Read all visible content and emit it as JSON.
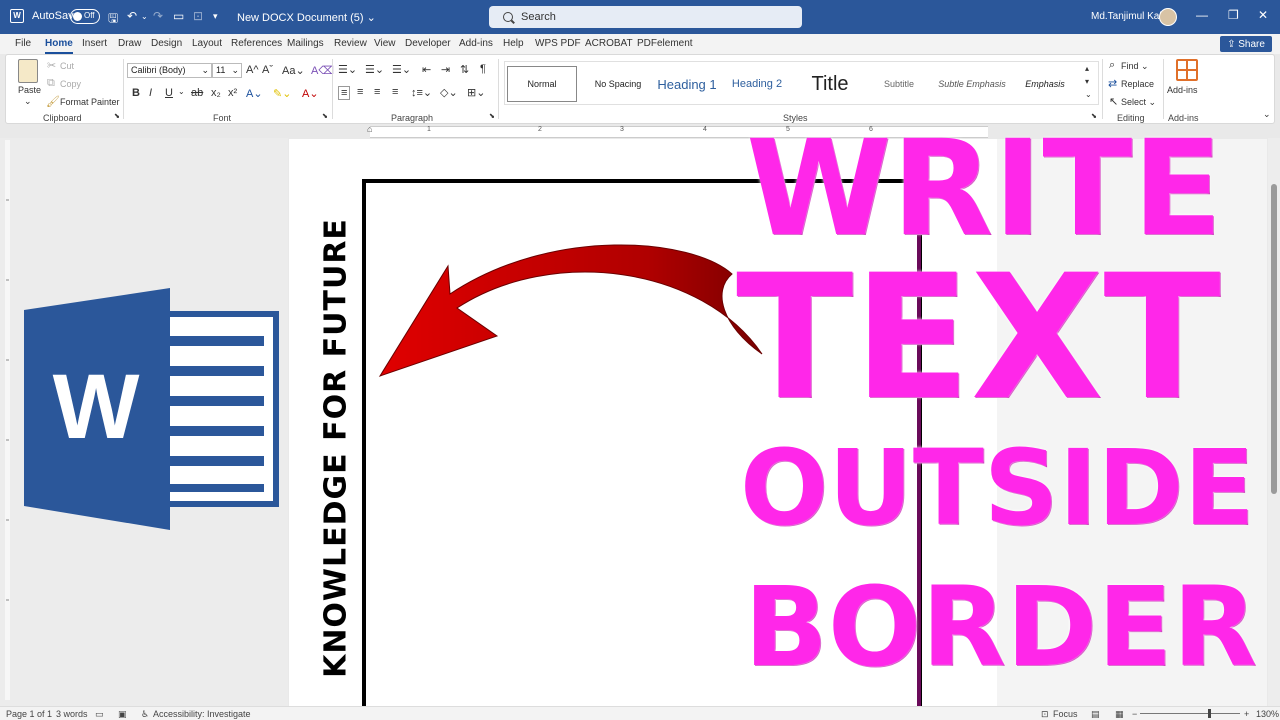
{
  "titlebar": {
    "autosave_label": "AutoSave",
    "autosave_state": "Off",
    "doc_title": "New DOCX Document (5)",
    "search_placeholder": "Search",
    "user_name": "Md.Tanjimul Kabir"
  },
  "menu": {
    "tabs": [
      "File",
      "Home",
      "Insert",
      "Draw",
      "Design",
      "Layout",
      "References",
      "Mailings",
      "Review",
      "View",
      "Developer",
      "Add-ins",
      "Help",
      "WPS PDF",
      "ACROBAT",
      "PDFelement"
    ],
    "active": "Home",
    "share_label": "Share"
  },
  "ribbon": {
    "clipboard": {
      "paste": "Paste",
      "cut": "Cut",
      "copy": "Copy",
      "format_painter": "Format Painter",
      "label": "Clipboard"
    },
    "font": {
      "name": "Calibri (Body)",
      "size": "11",
      "label": "Font"
    },
    "paragraph": {
      "label": "Paragraph"
    },
    "styles": {
      "items": [
        "Normal",
        "No Spacing",
        "Heading 1",
        "Heading 2",
        "Title",
        "Subtitle",
        "Subtle Emphasis",
        "Emphasis"
      ],
      "selected": "Normal",
      "label": "Styles"
    },
    "editing": {
      "find": "Find",
      "replace": "Replace",
      "select": "Select",
      "label": "Editing"
    },
    "addins": {
      "button": "Add-ins",
      "label": "Add-ins"
    }
  },
  "ruler": {
    "numbers": [
      "1",
      "1",
      "2",
      "3",
      "4",
      "5",
      "6"
    ]
  },
  "document": {
    "vertical_text": "KNOWLEDGE FOR FUTURE",
    "headline": [
      "WRITE",
      "TEXT",
      "OUTSIDE",
      "BORDER"
    ],
    "headline_color": "#ff27e9",
    "logo_letter": "W"
  },
  "statusbar": {
    "page": "Page 1 of 1",
    "words": "3 words",
    "accessibility": "Accessibility: Investigate",
    "focus": "Focus",
    "zoom": "130%"
  },
  "colors": {
    "titlebar": "#2b579a",
    "accent": "#1a4f9c",
    "word_blue": "#2b579a"
  }
}
